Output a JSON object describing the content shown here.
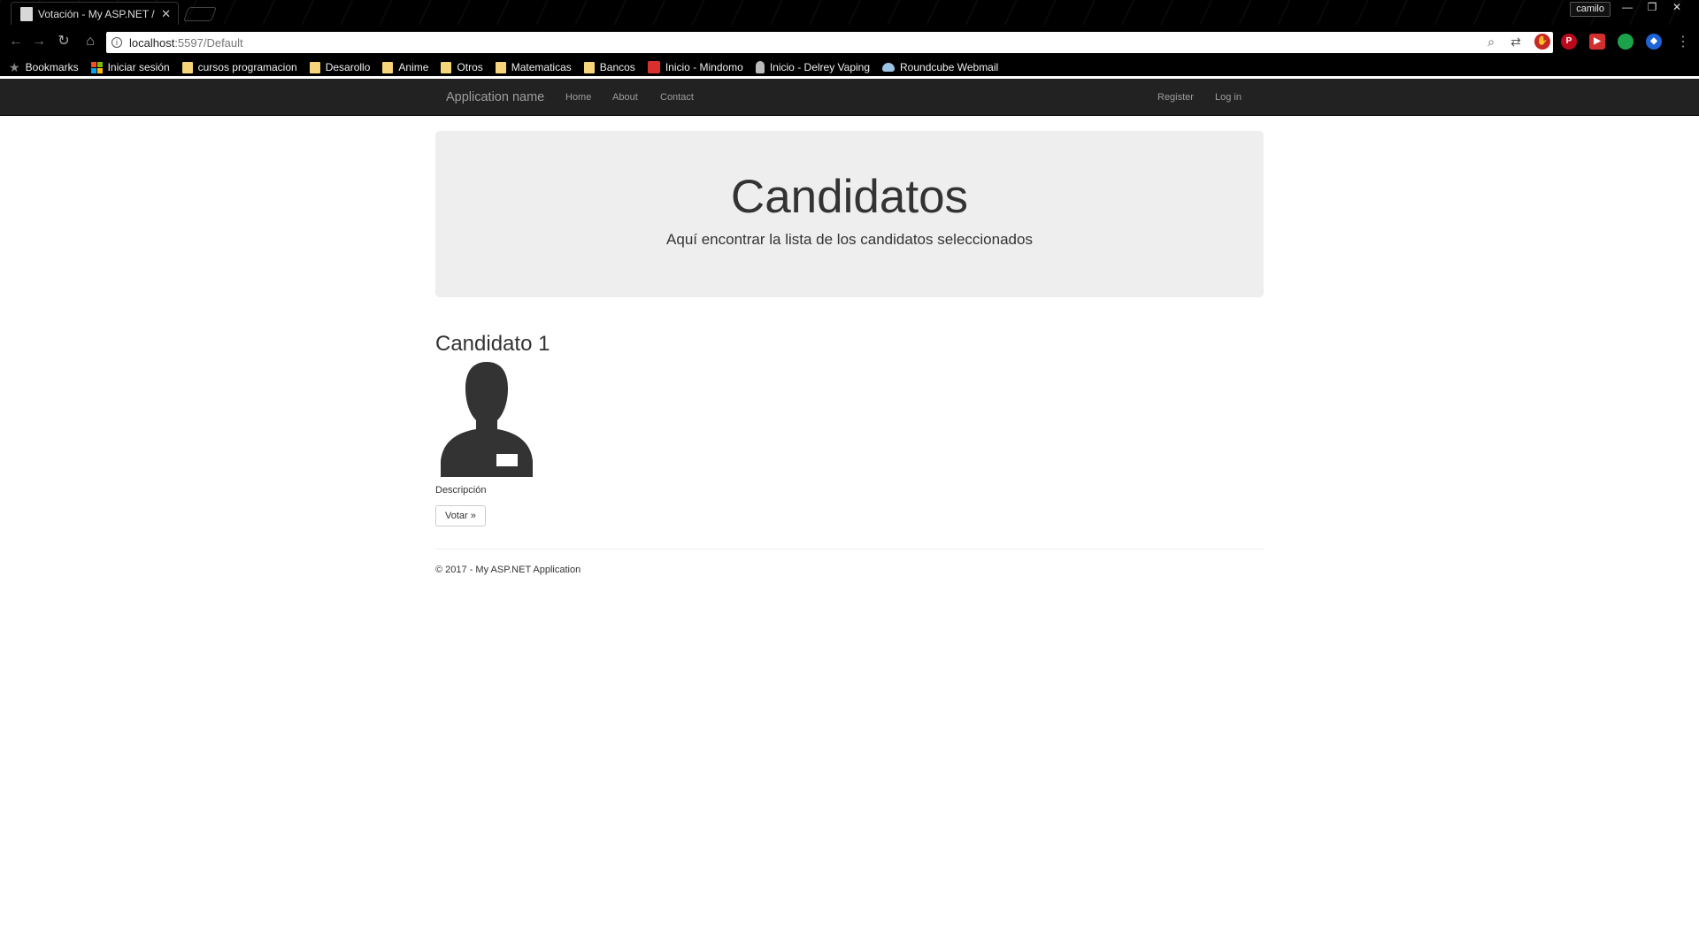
{
  "browser": {
    "tab_title": "Votación - My ASP.NET /",
    "profile_name": "camilo",
    "url_host": "localhost",
    "url_rest": ":5597/Default",
    "bookmarks": [
      {
        "label": "Bookmarks",
        "icon": "star-icon"
      },
      {
        "label": "Iniciar sesión",
        "icon": "microsoft-icon"
      },
      {
        "label": "cursos programacion",
        "icon": "folder-icon"
      },
      {
        "label": "Desarollo",
        "icon": "folder-icon"
      },
      {
        "label": "Anime",
        "icon": "folder-icon"
      },
      {
        "label": "Otros",
        "icon": "folder-icon"
      },
      {
        "label": "Matematicas",
        "icon": "folder-icon"
      },
      {
        "label": "Bancos",
        "icon": "folder-icon"
      },
      {
        "label": "Inicio - Mindomo",
        "icon": "mindomo-icon"
      },
      {
        "label": "Inicio - Delrey Vaping",
        "icon": "vape-icon"
      },
      {
        "label": "Roundcube Webmail",
        "icon": "roundcube-icon"
      }
    ]
  },
  "navbar": {
    "brand": "Application name",
    "links": [
      "Home",
      "About",
      "Contact"
    ],
    "right_links": [
      "Register",
      "Log in"
    ]
  },
  "jumbotron": {
    "title": "Candidatos",
    "lead": "Aquí encontrar la lista de los candidatos seleccionados"
  },
  "candidate": {
    "title": "Candidato 1",
    "description": "Descripción",
    "vote_label": "Votar »"
  },
  "footer": {
    "text": "© 2017 - My ASP.NET Application"
  },
  "colors": {
    "navbar_bg": "#222222",
    "navbar_text": "#9d9d9d",
    "jumbotron_bg": "#eeeeee",
    "text": "#333333"
  }
}
